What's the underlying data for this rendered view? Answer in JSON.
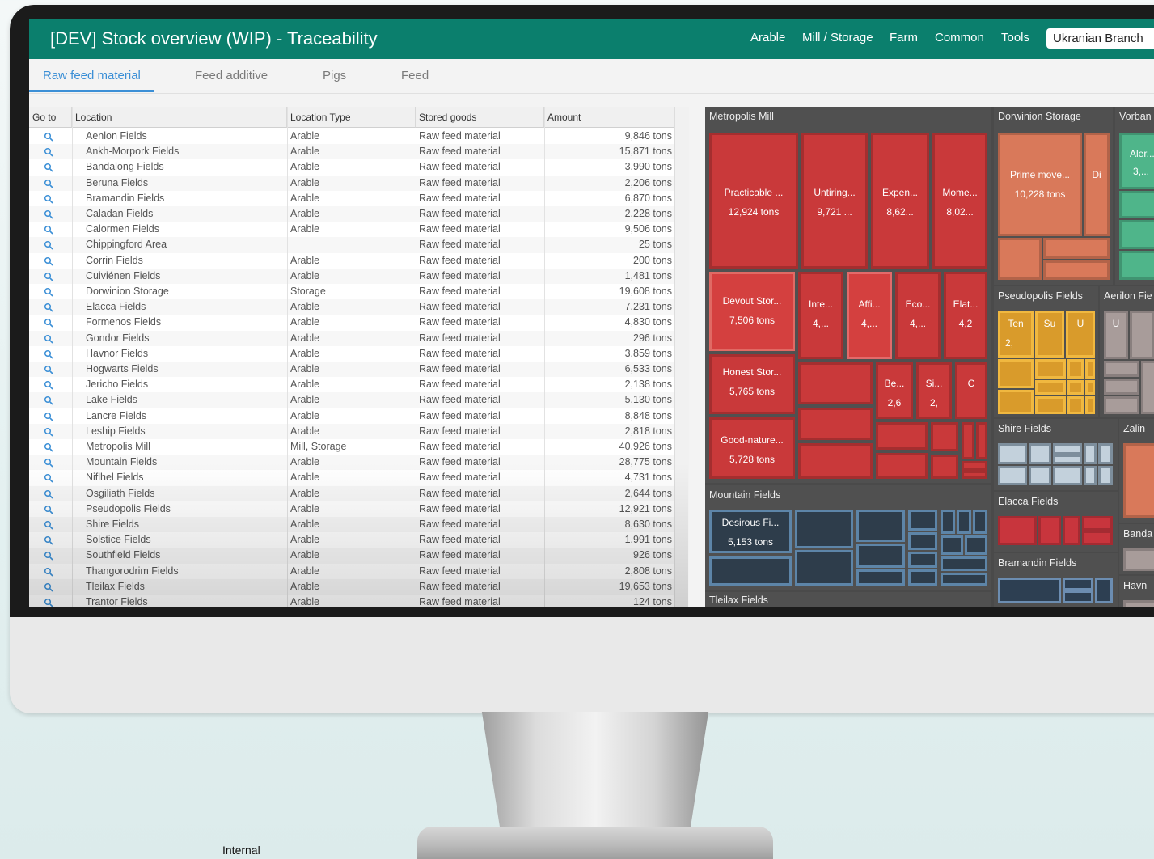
{
  "app": {
    "title": "[DEV] Stock overview (WIP) - Traceability",
    "nav": [
      "Arable",
      "Mill / Storage",
      "Farm",
      "Common",
      "Tools"
    ],
    "branch": "Ukranian Branch"
  },
  "tabs": [
    "Raw feed material",
    "Feed additive",
    "Pigs",
    "Feed"
  ],
  "table": {
    "columns": [
      "Go to",
      "Location",
      "Location Type",
      "Stored goods",
      "Amount"
    ],
    "rows": [
      {
        "location": "Aenlon Fields",
        "type": "Arable",
        "goods": "Raw feed material",
        "amount": "9,846 tons"
      },
      {
        "location": "Ankh-Morpork Fields",
        "type": "Arable",
        "goods": "Raw feed material",
        "amount": "15,871 tons"
      },
      {
        "location": "Bandalong Fields",
        "type": "Arable",
        "goods": "Raw feed material",
        "amount": "3,990 tons"
      },
      {
        "location": "Beruna Fields",
        "type": "Arable",
        "goods": "Raw feed material",
        "amount": "2,206 tons"
      },
      {
        "location": "Bramandin Fields",
        "type": "Arable",
        "goods": "Raw feed material",
        "amount": "6,870 tons"
      },
      {
        "location": "Caladan Fields",
        "type": "Arable",
        "goods": "Raw feed material",
        "amount": "2,228 tons"
      },
      {
        "location": "Calormen Fields",
        "type": "Arable",
        "goods": "Raw feed material",
        "amount": "9,506 tons"
      },
      {
        "location": "Chippingford Area",
        "type": "",
        "goods": "Raw feed material",
        "amount": "25 tons"
      },
      {
        "location": "Corrin Fields",
        "type": "Arable",
        "goods": "Raw feed material",
        "amount": "200 tons"
      },
      {
        "location": "Cuiviénen Fields",
        "type": "Arable",
        "goods": "Raw feed material",
        "amount": "1,481 tons"
      },
      {
        "location": "Dorwinion Storage",
        "type": "Storage",
        "goods": "Raw feed material",
        "amount": "19,608 tons"
      },
      {
        "location": "Elacca Fields",
        "type": "Arable",
        "goods": "Raw feed material",
        "amount": "7,231 tons"
      },
      {
        "location": "Formenos Fields",
        "type": "Arable",
        "goods": "Raw feed material",
        "amount": "4,830 tons"
      },
      {
        "location": "Gondor Fields",
        "type": "Arable",
        "goods": "Raw feed material",
        "amount": "296 tons"
      },
      {
        "location": "Havnor Fields",
        "type": "Arable",
        "goods": "Raw feed material",
        "amount": "3,859 tons"
      },
      {
        "location": "Hogwarts Fields",
        "type": "Arable",
        "goods": "Raw feed material",
        "amount": "6,533 tons"
      },
      {
        "location": "Jericho Fields",
        "type": "Arable",
        "goods": "Raw feed material",
        "amount": "2,138 tons"
      },
      {
        "location": "Lake Fields",
        "type": "Arable",
        "goods": "Raw feed material",
        "amount": "5,130 tons"
      },
      {
        "location": "Lancre Fields",
        "type": "Arable",
        "goods": "Raw feed material",
        "amount": "8,848 tons"
      },
      {
        "location": "Leship Fields",
        "type": "Arable",
        "goods": "Raw feed material",
        "amount": "2,818 tons"
      },
      {
        "location": "Metropolis Mill",
        "type": "Mill, Storage",
        "goods": "Raw feed material",
        "amount": "40,926 tons"
      },
      {
        "location": "Mountain Fields",
        "type": "Arable",
        "goods": "Raw feed material",
        "amount": "28,775 tons"
      },
      {
        "location": "Niflhel Fields",
        "type": "Arable",
        "goods": "Raw feed material",
        "amount": "4,731 tons"
      },
      {
        "location": "Osgiliath Fields",
        "type": "Arable",
        "goods": "Raw feed material",
        "amount": "2,644 tons"
      },
      {
        "location": "Pseudopolis Fields",
        "type": "Arable",
        "goods": "Raw feed material",
        "amount": "12,921 tons"
      },
      {
        "location": "Shire Fields",
        "type": "Arable",
        "goods": "Raw feed material",
        "amount": "8,630 tons"
      },
      {
        "location": "Solstice Fields",
        "type": "Arable",
        "goods": "Raw feed material",
        "amount": "1,991 tons"
      },
      {
        "location": "Southfield Fields",
        "type": "Arable",
        "goods": "Raw feed material",
        "amount": "926 tons"
      },
      {
        "location": "Thangorodrim Fields",
        "type": "Arable",
        "goods": "Raw feed material",
        "amount": "2,808 tons"
      },
      {
        "location": "Tleilax Fields",
        "type": "Arable",
        "goods": "Raw feed material",
        "amount": "19,653 tons"
      },
      {
        "location": "Trantor Fields",
        "type": "Arable",
        "goods": "Raw feed material",
        "amount": "124 tons"
      }
    ]
  },
  "treemap": {
    "groups": {
      "metropolis": "Metropolis Mill",
      "dorwinion": "Dorwinion Storage",
      "vorban": "Vorban",
      "pseudopolis": "Pseudopolis Fields",
      "aerilon": "Aerilon Fie",
      "shire": "Shire Fields",
      "zalin": "Zalin",
      "elacca": "Elacca Fields",
      "banda": "Banda",
      "bramandin": "Bramandin Fields",
      "havn": "Havn",
      "mountain": "Mountain Fields",
      "tleilax": "Tleilax Fields"
    },
    "tiles": {
      "practicable": {
        "name": "Practicable ...",
        "value": "12,924 tons"
      },
      "untiring": {
        "name": "Untiring...",
        "value": "9,721 ..."
      },
      "expen": {
        "name": "Expen...",
        "value": "8,62..."
      },
      "mome": {
        "name": "Mome...",
        "value": "8,02..."
      },
      "devout": {
        "name": "Devout Stor...",
        "value": "7,506 tons"
      },
      "inte": {
        "name": "Inte...",
        "value": "4,..."
      },
      "affi": {
        "name": "Affi...",
        "value": "4,..."
      },
      "eco": {
        "name": "Eco...",
        "value": "4,..."
      },
      "elat": {
        "name": "Elat...",
        "value": "4,2"
      },
      "honest": {
        "name": "Honest Stor...",
        "value": "5,765 tons"
      },
      "be": {
        "name": "Be...",
        "value": "2,6"
      },
      "si": {
        "name": "Si...",
        "value": "2,"
      },
      "c": {
        "name": "C",
        "value": ""
      },
      "good": {
        "name": "Good-nature...",
        "value": "5,728 tons"
      },
      "prime": {
        "name": "Prime move...",
        "value": "10,228 tons"
      },
      "di": {
        "name": "Di",
        "value": ""
      },
      "aler": {
        "name": "Aler...",
        "value": "3,..."
      },
      "ten": {
        "name": "Ten",
        "value": "2,"
      },
      "su": {
        "name": "Su",
        "value": ""
      },
      "u1": {
        "name": "U",
        "value": ""
      },
      "u2": {
        "name": "U",
        "value": ""
      },
      "desirous": {
        "name": "Desirous Fi...",
        "value": "5,153 tons"
      }
    }
  },
  "footer": {
    "label": "Internal"
  },
  "colors": {
    "header": "#0b7f6d",
    "accent": "#3b8fd6",
    "mill": "#c9393a",
    "storage": "#d9795a",
    "mountain": "#2e3d4b",
    "pseudopolis": "#d99b2b"
  }
}
